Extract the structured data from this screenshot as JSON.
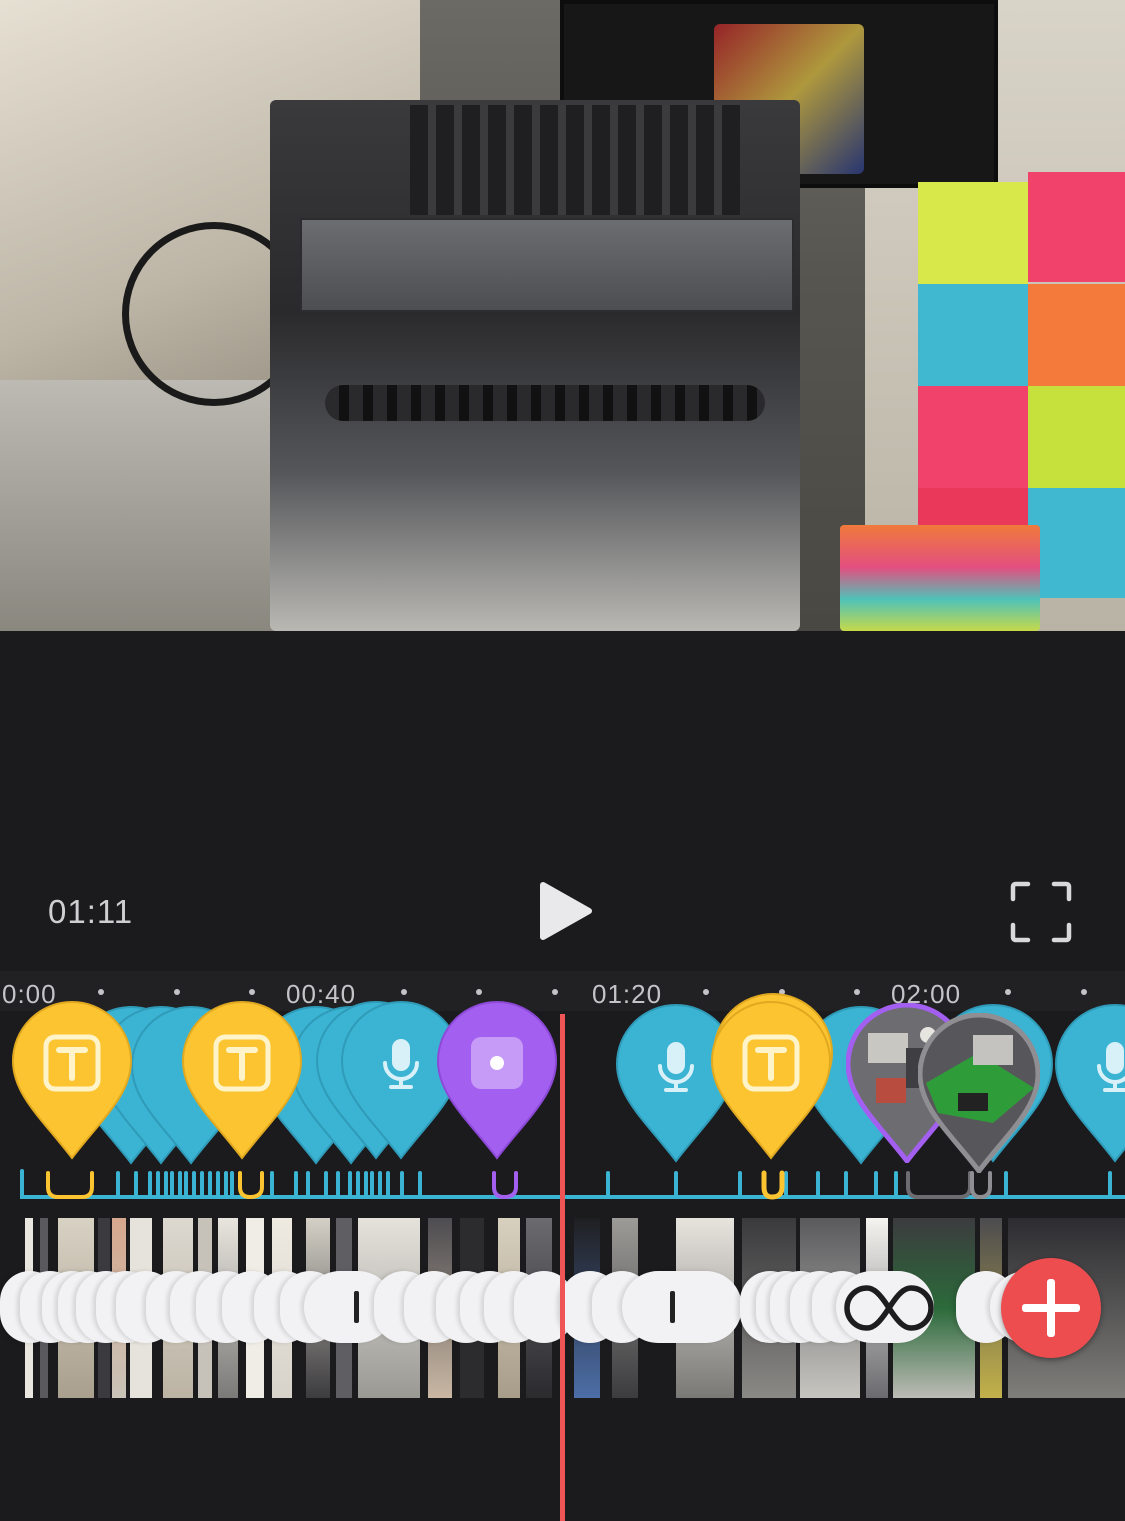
{
  "player": {
    "current_time": "01:11",
    "play_icon": "play-icon",
    "fullscreen_icon": "fullscreen-icon"
  },
  "ruler": {
    "labels": [
      "0:00",
      "00:40",
      "01:20",
      "02:00"
    ]
  },
  "markers": [
    {
      "type": "title",
      "icon": "text-icon",
      "color": "#fbc430"
    },
    {
      "type": "title",
      "icon": "text-icon",
      "color": "#fbc430"
    },
    {
      "type": "voiceover",
      "icon": "microphone-icon",
      "color": "#3bb3d3"
    },
    {
      "type": "sound",
      "icon": "audio-icon",
      "color": "#a35ff0"
    },
    {
      "type": "voiceover",
      "icon": "microphone-icon",
      "color": "#3bb3d3"
    },
    {
      "type": "title",
      "icon": "text-icon",
      "color": "#fbc430"
    },
    {
      "type": "overlay",
      "icon": "photo-thumbnail",
      "color": "#8f8f93"
    },
    {
      "type": "overlay",
      "icon": "photo-thumbnail",
      "color": "#8f8f93"
    },
    {
      "type": "voiceover",
      "icon": "microphone-icon",
      "color": "#3bb3d3"
    }
  ],
  "colors": {
    "accent_blue": "#3bb3d3",
    "accent_yellow": "#fbc430",
    "accent_purple": "#a35ff0",
    "playhead": "#f05556",
    "add_button": "#ee4d4f"
  },
  "controls": {
    "loop_icon": "loop-icon",
    "add_icon": "plus-icon"
  }
}
